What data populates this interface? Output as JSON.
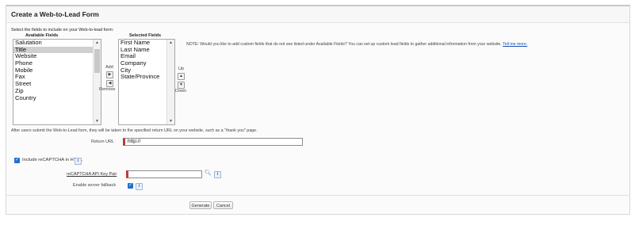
{
  "page": {
    "title": "Create a Web-to-Lead Form",
    "instruction": "Select the fields to include on your Web-to-lead form:"
  },
  "available_fields": {
    "heading": "Available Fields",
    "items": [
      "Salutation",
      "Title",
      "Website",
      "Phone",
      "Mobile",
      "Fax",
      "Street",
      "Zip",
      "Country"
    ],
    "selected_item": "Title"
  },
  "selected_fields": {
    "heading": "Selected Fields",
    "items": [
      "First Name",
      "Last Name",
      "Email",
      "Company",
      "City",
      "State/Province"
    ]
  },
  "buttons": {
    "add": "Add",
    "remove": "Remove",
    "up": "Up",
    "down": "Down",
    "generate": "Generate",
    "cancel": "Cancel"
  },
  "note": {
    "text": "NOTE: Would you like to add custom fields that do not see listed under Available Fields? You can set up custom lead fields to gather additional information from your website.",
    "link_text": "Tell me more."
  },
  "return_url": {
    "description": "After users submit the Web-to-Lead form, they will be taken to the specified return URL on your website, such as a \"thank you\" page.",
    "label": "Return URL",
    "value": "http://"
  },
  "recaptcha": {
    "include_label": "Include reCAPTCHA in HTML",
    "include_checked": true,
    "key_pair_label": "reCAPTCHA API Key Pair",
    "key_pair_value": "",
    "fallback_label": "Enable server fallback",
    "fallback_checked": true
  },
  "icons": {
    "info": "info-icon",
    "lookup": "search-lookup-icon",
    "check": "checkmark-icon"
  },
  "colors": {
    "required_bar": "#c23934",
    "checkbox": "#1f6fd1",
    "link": "#1a4fb4",
    "selected_row": "#cfcfcf"
  }
}
